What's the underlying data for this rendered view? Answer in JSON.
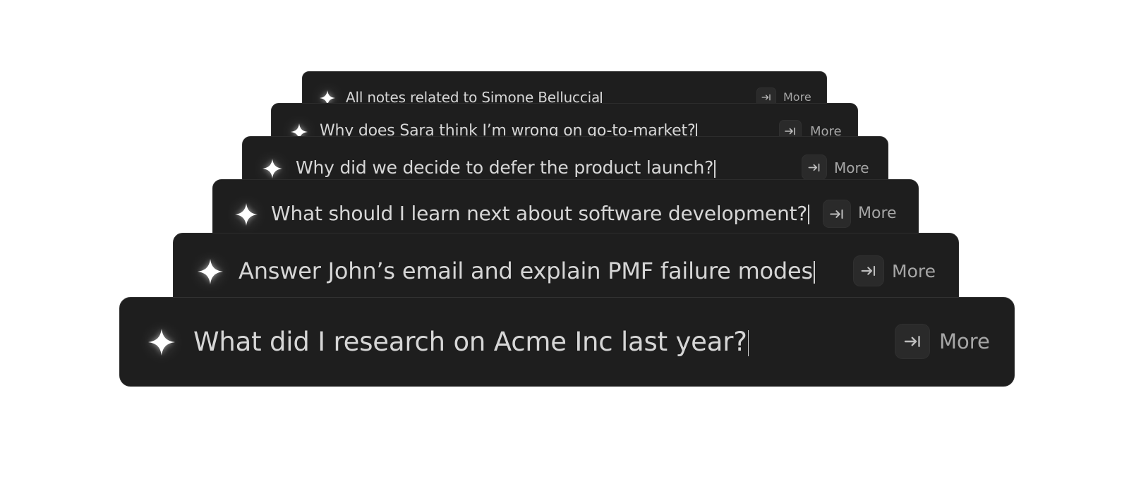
{
  "colors": {
    "page_background": "#ffffff",
    "bar_background": "#1e1e1e",
    "text": "#d6d6d6",
    "muted_text": "#a6a6a6",
    "key_background": "#2a2a2a"
  },
  "icons": {
    "leading": "sparkle-icon",
    "shortcut": "tab-arrow-icon"
  },
  "prompts": [
    {
      "text": "All notes related to Simone Belluccia",
      "more_label": "More"
    },
    {
      "text": "Why does Sara think I’m wrong on go-to-market?",
      "more_label": "More"
    },
    {
      "text": "Why did we decide to defer the product launch?",
      "more_label": "More"
    },
    {
      "text": "What should I learn next about software development?",
      "more_label": "More"
    },
    {
      "text": "Answer John’s email and explain PMF failure modes",
      "more_label": "More"
    },
    {
      "text": "What did I research on Acme Inc last year?",
      "more_label": "More"
    }
  ]
}
